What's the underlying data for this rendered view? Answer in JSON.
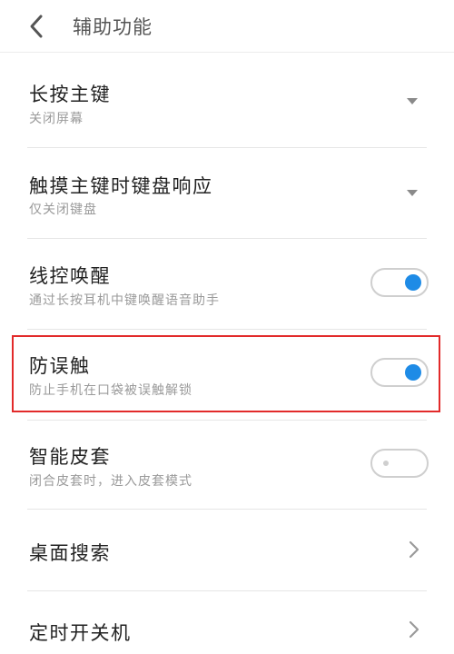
{
  "header": {
    "back_icon": "chevron-left-icon",
    "title": "辅助功能"
  },
  "settings": [
    {
      "title": "长按主键",
      "subtitle": "关闭屏幕",
      "control": "dropdown"
    },
    {
      "title": "触摸主键时键盘响应",
      "subtitle": "仅关闭键盘",
      "control": "dropdown"
    },
    {
      "title": "线控唤醒",
      "subtitle": "通过长按耳机中键唤醒语音助手",
      "control": "toggle",
      "on": true
    },
    {
      "title": "防误触",
      "subtitle": "防止手机在口袋被误触解锁",
      "control": "toggle",
      "on": true,
      "highlighted": true
    },
    {
      "title": "智能皮套",
      "subtitle": "闭合皮套时，进入皮套模式",
      "control": "toggle",
      "on": false
    },
    {
      "title": "桌面搜索",
      "control": "chevron"
    },
    {
      "title": "定时开关机",
      "control": "chevron"
    }
  ],
  "colors": {
    "toggle_on": "#1e8be6",
    "highlight": "#e22a2a"
  }
}
